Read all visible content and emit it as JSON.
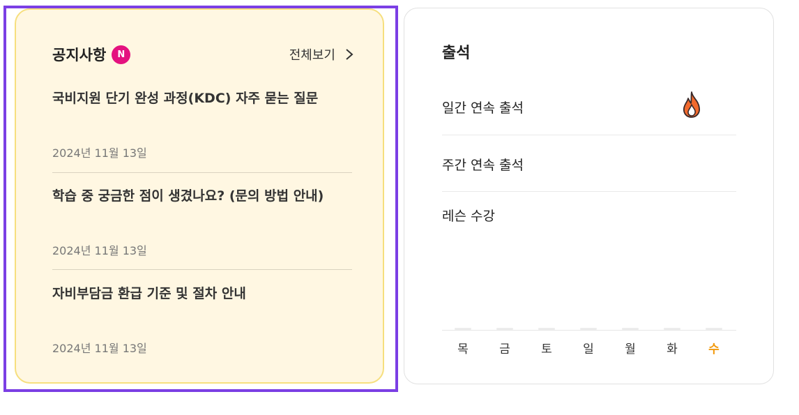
{
  "notices": {
    "title": "공지사항",
    "new_badge": "N",
    "view_all": "전체보기",
    "items": [
      {
        "title": "국비지원 단기 완성 과정(KDC) 자주 묻는 질문",
        "date": "2024년 11월 13일"
      },
      {
        "title": "학습 중 궁금한 점이 생겼나요? (문의 방법 안내)",
        "date": "2024년 11월 13일"
      },
      {
        "title": "자비부담금 환급 기준 및 절차 안내",
        "date": "2024년 11월 13일"
      }
    ]
  },
  "attendance": {
    "title": "출석",
    "rows": [
      {
        "label": "일간 연속 출석"
      },
      {
        "label": "주간 연속 출석"
      },
      {
        "label": "레슨 수강"
      }
    ],
    "streak_icon": "fire-icon",
    "days": [
      "목",
      "금",
      "토",
      "일",
      "월",
      "화",
      "수"
    ],
    "today_index": 6,
    "today_color": "#f29a0e"
  },
  "colors": {
    "focus_outline": "#7b3fe4",
    "notice_background": "#fff7e2",
    "notice_border": "#f6df7e",
    "badge": "#e4127f"
  }
}
